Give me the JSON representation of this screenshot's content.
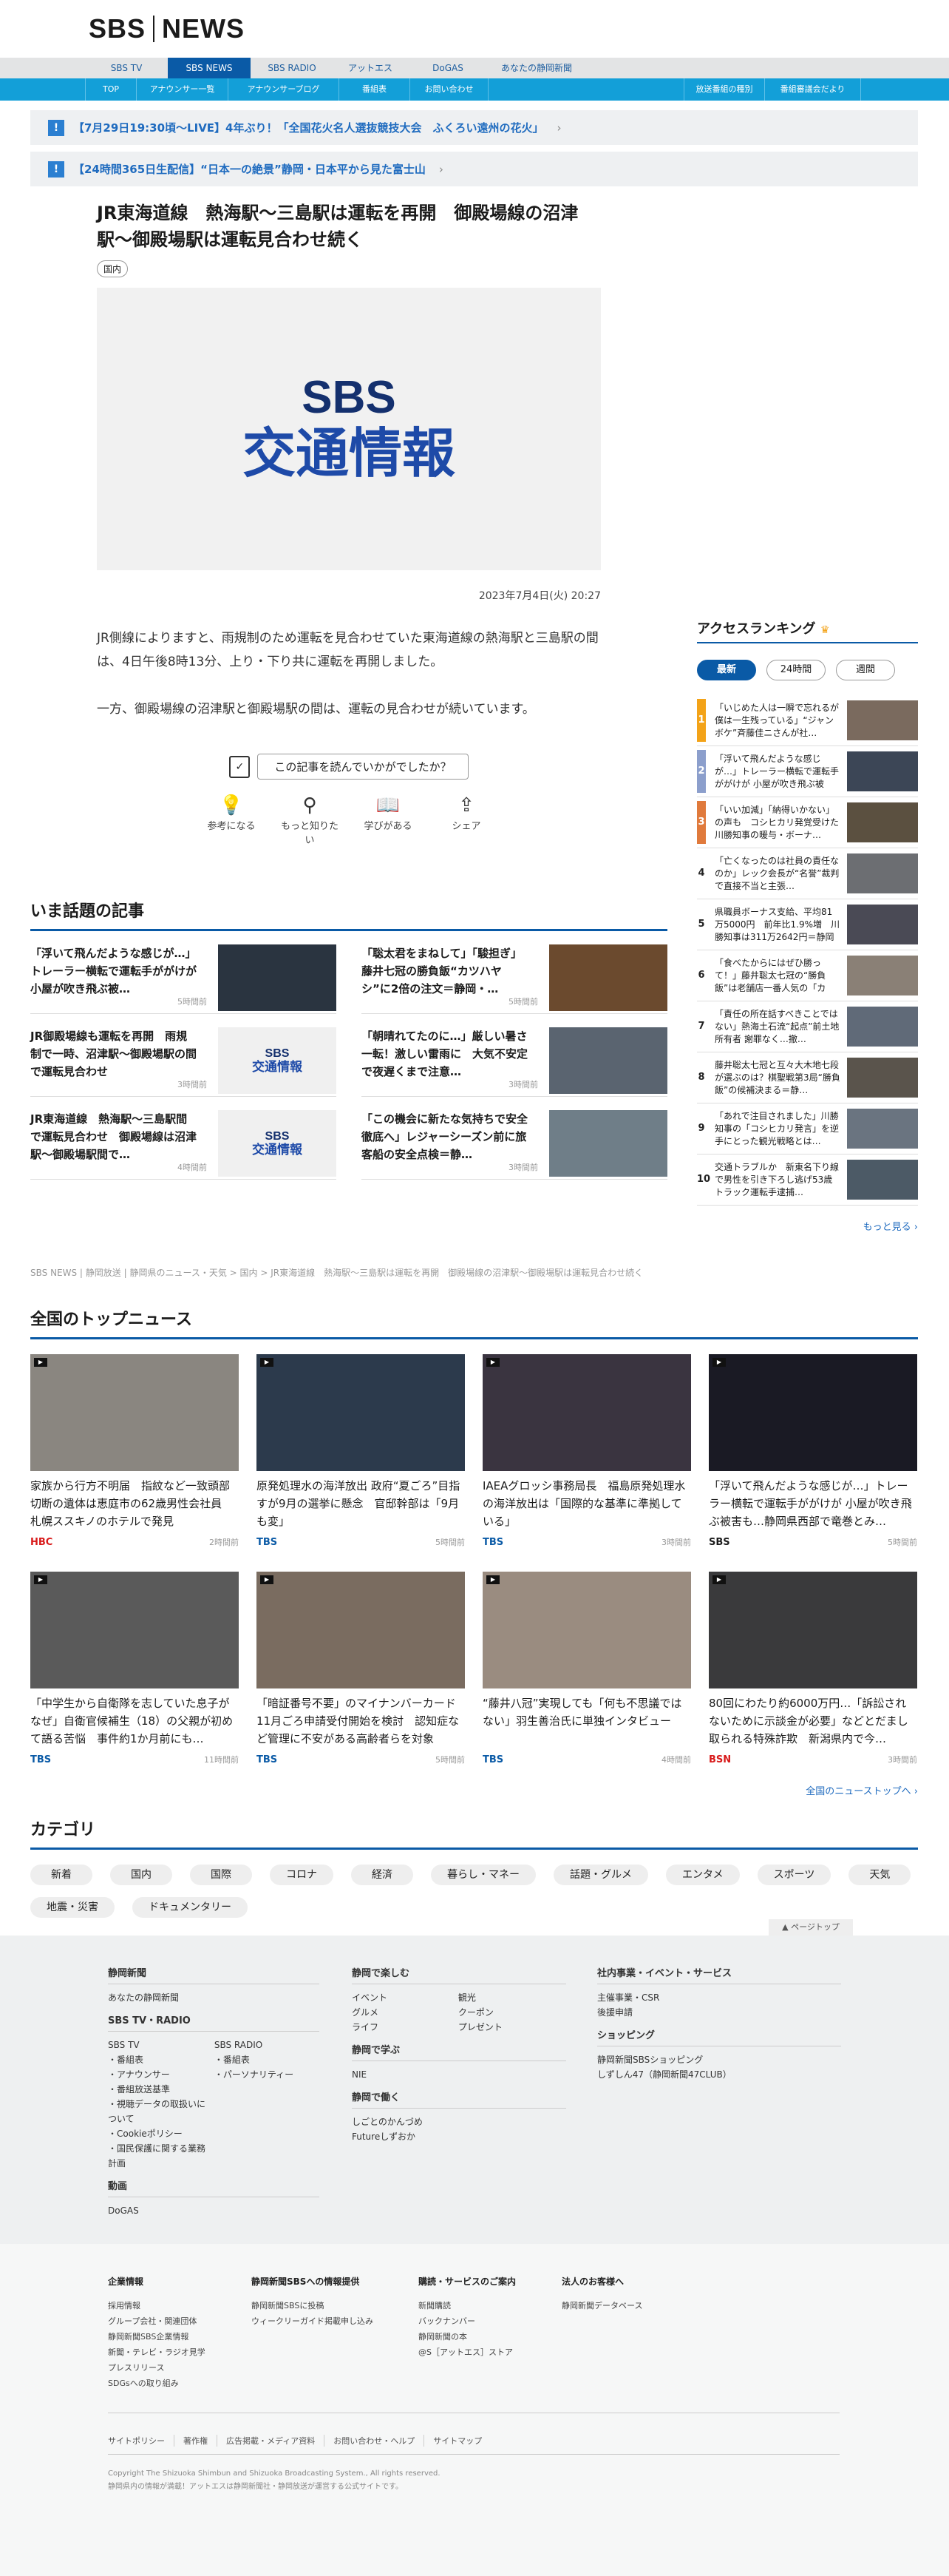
{
  "header": {
    "logo_left": "SBS",
    "logo_right": "NEWS"
  },
  "global_nav": [
    "SBS TV",
    "SBS NEWS",
    "SBS RADIO",
    "アットエス",
    "DoGAS",
    "あなたの静岡新聞"
  ],
  "sub_nav": [
    "TOP",
    "アナウンサー一覧",
    "アナウンサーブログ",
    "番組表",
    "お問い合わせ",
    "放送番組の種別",
    "番組審議会だより"
  ],
  "alerts": [
    {
      "text": "【7月29日19:30頃〜LIVE】4年ぶり！「全国花火名人選抜競技大会　ふくろい遠州の花火」"
    },
    {
      "text": "【24時間365日生配信】“日本一の絶景”静岡・日本平から見た富士山"
    }
  ],
  "article": {
    "title": "JR東海道線　熱海駅〜三島駅は運転を再開　御殿場線の沼津駅〜御殿場駅は運転見合わせ続く",
    "tag": "国内",
    "hero_line1": "SBS",
    "hero_line2": "交通情報",
    "date": "2023年7月4日(火) 20:27",
    "paragraphs": [
      "JR側線によりますと、雨規制のため運転を見合わせていた東海道線の熱海駅と三島駅の間は、4日午後8時13分、上り・下り共に運転を再開しました。",
      "一方、御殿場線の沼津駅と御殿場駅の間は、運転の見合わせが続いています。"
    ],
    "survey": "この記事を読んでいかがでしたか？",
    "reactions": [
      "参考になる",
      "もっと知りたい",
      "学びがある",
      "シェア"
    ]
  },
  "topics": {
    "title": "いま話題の記事",
    "items": [
      {
        "title": "「浮いて飛んだような感じが…」トレーラー横転で運転手ががけが 小屋が吹き飛ぶ被…",
        "time": "5時間前",
        "traffic": false
      },
      {
        "title": "「聡太君をまねして」「駿担ぎ」藤井七冠の勝負飯“カツハヤシ”に2倍の注文＝静岡・…",
        "time": "5時間前",
        "traffic": false
      },
      {
        "title": "JR御殿場線も運転を再開　雨規制で一時、沼津駅〜御殿場駅の間で運転見合わせ",
        "time": "3時間前",
        "traffic": true
      },
      {
        "title": "「朝晴れてたのに…」厳しい暑さ一転！激しい雷雨に　大気不安定で夜遅くまで注意…",
        "time": "3時間前",
        "traffic": false
      },
      {
        "title": "JR東海道線　熱海駅〜三島駅間で運転見合わせ　御殿場線は沼津駅〜御殿場駅間で…",
        "time": "4時間前",
        "traffic": true
      },
      {
        "title": "「この機会に新たな気持ちで安全徹底へ」レジャーシーズン前に旅客船の安全点検＝静…",
        "time": "3時間前",
        "traffic": false
      }
    ],
    "traffic_a": "SBS",
    "traffic_b": "交通情報"
  },
  "ranking": {
    "title": "アクセスランキング",
    "tabs": [
      "最新",
      "24時間",
      "週間"
    ],
    "items": [
      {
        "n": "1",
        "text": "「いじめた人は一瞬で忘れるが僕は一生残っている」“ジャンボケ”斉藤佳ニさんが社…",
        "color": "#f3a318"
      },
      {
        "n": "2",
        "text": "「浮いて飛んだような感じが…」トレーラー横転で運転手ががけが 小屋が吹き飛ぶ被害…",
        "color": "#8c9fcc"
      },
      {
        "n": "3",
        "text": "「いい加減」「納得いかない」の声も　コシヒカリ発覚受けた川勝知事の暖与・ボーナ…",
        "color": "#e07a3c"
      },
      {
        "n": "4",
        "text": "「亡くなったのは社員の責任なのか」レック会長が“名誉”裁判で直接不当と主張…",
        "color": ""
      },
      {
        "n": "5",
        "text": "県職員ボーナス支給、平均81万5000円　前年比1.9%増　川勝知事は311万2642円＝静岡",
        "color": ""
      },
      {
        "n": "6",
        "text": "「食べたからにはぜひ勝って！」藤井聡太七冠の“勝負飯”は老舗店一番人気の「カツ…",
        "color": ""
      },
      {
        "n": "7",
        "text": "「責任の所在話すべきことではない」熱海土石流“起点”前土地所有者 謝罪なく…撤…",
        "color": ""
      },
      {
        "n": "8",
        "text": "藤井聡太七冠と互々大木地七段が選ぶのは？棋聖戦第3局“勝負飯”の候補決まる＝静…",
        "color": ""
      },
      {
        "n": "9",
        "text": "「あれで注目されました」川勝知事の「コシヒカリ発言」を逆手にとった観光戦略とは…",
        "color": ""
      },
      {
        "n": "10",
        "text": "交通トラブルか　新東名下り線で男性を引き下ろし逃げ53歳トラック運転手逮捕…",
        "color": ""
      }
    ],
    "more": "もっと見る"
  },
  "breadcrumb": "SBS NEWS | 静岡放送 | 静岡県のニュース・天気 > 国内 > JR東海道線　熱海駅〜三島駅は運転を再開　御殿場線の沼津駅〜御殿場駅は運転見合わせ続く",
  "national": {
    "title": "全国のトップニュース",
    "items": [
      {
        "title": "家族から行方不明届　指紋など一致頭部切断の遺体は恵庭市の62歳男性会社員　札幌ススキノのホテルで発見",
        "src": "HBC",
        "time": "2時間前",
        "src_color": "#d81a1a"
      },
      {
        "title": "原発処理水の海洋放出 政府“夏ごろ”目指すが9月の選挙に懸念　官邸幹部は「9月も変」",
        "src": "TBS",
        "time": "5時間前",
        "src_color": "#0a5aa6"
      },
      {
        "title": "IAEAグロッシ事務局長　福島原発処理水の海洋放出は「国際的な基準に準拠している」",
        "src": "TBS",
        "time": "3時間前",
        "src_color": "#0a5aa6"
      },
      {
        "title": "「浮いて飛んだような感じが…」トレーラー横転で運転手ががけが 小屋が吹き飛ぶ被害も…静岡県西部で竜巻とみ…",
        "src": "SBS",
        "time": "5時間前",
        "src_color": "#1b1b1b"
      },
      {
        "title": "「中学生から自衛隊を志していた息子がなぜ」自衛官候補生（18）の父親が初めて語る苦悩　事件約1か月前にも…",
        "src": "TBS",
        "time": "11時間前",
        "src_color": "#0a5aa6"
      },
      {
        "title": "「暗証番号不要」のマイナンバーカード 11月ごろ申請受付開始を検討　認知症など管理に不安がある高齢者らを対象",
        "src": "TBS",
        "time": "5時間前",
        "src_color": "#0a5aa6"
      },
      {
        "title": "“藤井八冠”実現しても「何も不思議ではない」羽生善治氏に単独インタビュー",
        "src": "TBS",
        "time": "4時間前",
        "src_color": "#0a5aa6"
      },
      {
        "title": "80回にわたり約6000万円…「訴訟されないために示談金が必要」などとだまし取られる特殊詐欺　新潟県内で今…",
        "src": "BSN",
        "time": "3時間前",
        "src_color": "#d81a1a"
      }
    ],
    "more": "全国のニューストップへ"
  },
  "categories": {
    "title": "カテゴリ",
    "chips": [
      "新着",
      "国内",
      "国際",
      "コロナ",
      "経済",
      "暮らし・マネー",
      "話題・グルメ",
      "エンタメ",
      "スポーツ",
      "天気",
      "地震・災害",
      "ドキュメンタリー"
    ]
  },
  "pagetop": "ページトップ",
  "footer1": {
    "col1": {
      "h1": "静岡新聞",
      "h1_items": [
        "あなたの静岡新聞"
      ],
      "h2": "SBS TV・RADIO",
      "tv_title": "SBS TV",
      "tv_items": [
        "・番組表",
        "・アナウンサー",
        "・番組放送基準",
        "・視聴データの取扱いについて",
        "・Cookieポリシー",
        "・国民保護に関する業務計画"
      ],
      "radio_title": "SBS RADIO",
      "radio_items": [
        "・番組表",
        "・パーソナリティー"
      ],
      "h3": "動画",
      "h3_items": [
        "DoGAS"
      ]
    },
    "col2": {
      "h1": "静岡で楽しむ",
      "h1_left": [
        "イベント",
        "グルメ",
        "ライフ"
      ],
      "h1_right": [
        "観光",
        "クーポン",
        "プレゼント"
      ],
      "h2": "静岡で学ぶ",
      "h2_items": [
        "NIE"
      ],
      "h3": "静岡で働く",
      "h3_items": [
        "しごとのかんづめ",
        "Futureしずおか"
      ]
    },
    "col3": {
      "h1": "社内事業・イベント・サービス",
      "h1_items": [
        "主催事業・CSR",
        "後援申請"
      ],
      "h2": "ショッピング",
      "h2_items": [
        "静岡新聞SBSショッピング",
        "しずしん47（静岡新聞47CLUB）"
      ]
    }
  },
  "footer2": {
    "cols": [
      {
        "title": "企業情報",
        "items": [
          "採用情報",
          "グループ会社・関連団体",
          "静岡新聞SBS企業情報",
          "新聞・テレビ・ラジオ見学",
          "プレスリリース",
          "SDGsへの取り組み"
        ]
      },
      {
        "title": "静岡新聞SBSへの情報提供",
        "items": [
          "静岡新聞SBSに投稿",
          "ウィークリーガイド掲載申し込み"
        ]
      },
      {
        "title": "購読・サービスのご案内",
        "items": [
          "新聞購読",
          "バックナンバー",
          "静岡新聞の本",
          "@S［アットエス］ストア"
        ]
      },
      {
        "title": "法人のお客様へ",
        "items": [
          "静岡新聞データベース"
        ]
      }
    ],
    "links": [
      "サイトポリシー",
      "著作権",
      "広告掲載・メディア資料",
      "お問い合わせ・ヘルプ",
      "サイトマップ"
    ],
    "copy1": "Copyright The Shizuoka Shimbun and Shizuoka Broadcasting System., All rights reserved.",
    "copy2": "静岡県内の情報が満載！アットエスは静岡新聞社・静岡放送が運営する公式サイトです。"
  },
  "colors": {
    "brand": "#0a5aa6",
    "subnav": "#139fd8",
    "alert": "#1f6bbf"
  }
}
